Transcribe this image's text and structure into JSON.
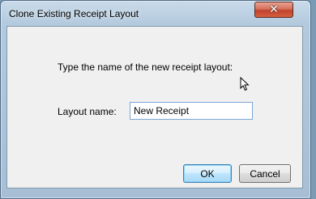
{
  "window": {
    "title": "Clone Existing Receipt Layout",
    "close_icon": "close-icon"
  },
  "dialog": {
    "prompt": "Type the name of the new receipt layout:",
    "layout_name_label": "Layout name:",
    "layout_name_value": "New Receipt",
    "ok_label": "OK",
    "cancel_label": "Cancel"
  }
}
